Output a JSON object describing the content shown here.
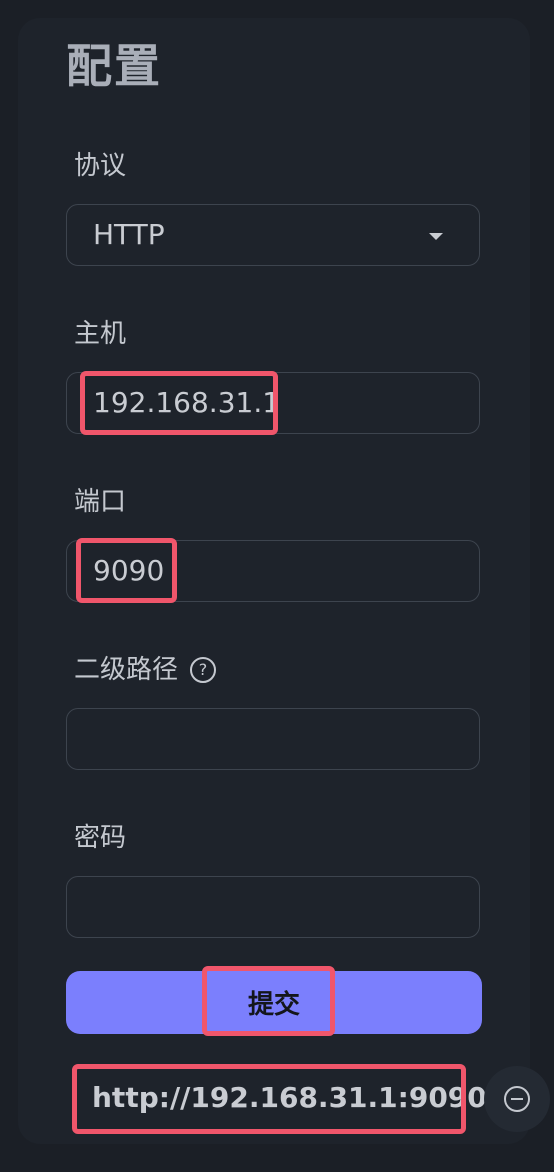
{
  "page": {
    "title": "配置"
  },
  "form": {
    "protocol": {
      "label": "协议",
      "value": "HTTP",
      "icon": "chevron-down-icon"
    },
    "host": {
      "label": "主机",
      "value": "192.168.31.1"
    },
    "port": {
      "label": "端口",
      "value": "9090"
    },
    "path": {
      "label": "二级路径",
      "value": "",
      "help_icon": "question-circle-icon",
      "help_glyph": "?"
    },
    "password": {
      "label": "密码",
      "value": ""
    },
    "submit_label": "提交"
  },
  "result": {
    "url": "http://192.168.31.1:9090"
  },
  "collapse_button": {
    "icon": "minus-circle-icon"
  },
  "colors": {
    "background": "#1b1f26",
    "card": "#1e232b",
    "accent": "#7b7ffd",
    "highlight": "#f0566b",
    "text": "#c9ccd2"
  }
}
